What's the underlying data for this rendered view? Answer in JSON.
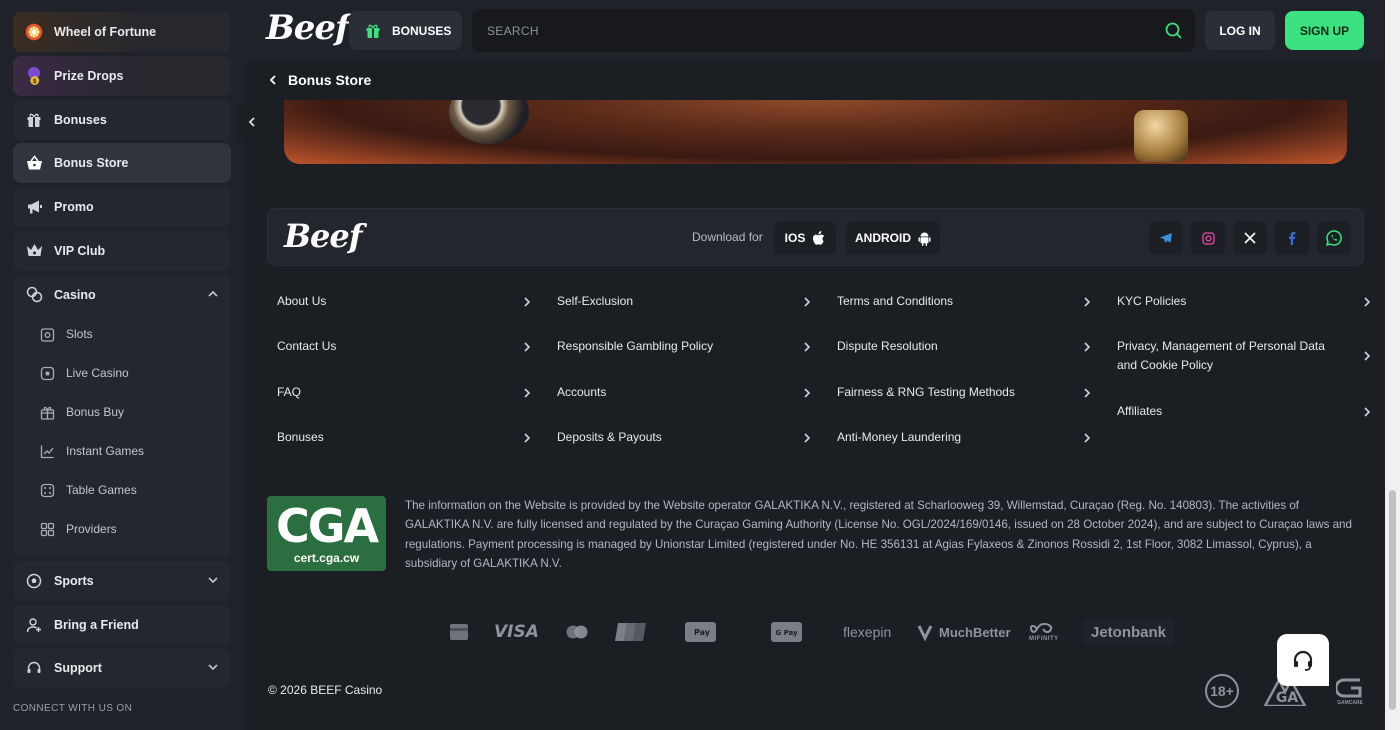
{
  "sidebar": {
    "top_items": [
      {
        "label": "Wheel of Fortune",
        "icon": "wheel-icon"
      },
      {
        "label": "Prize Drops",
        "icon": "prize-drops-icon"
      },
      {
        "label": "Bonuses",
        "icon": "gift-icon"
      },
      {
        "label": "Bonus Store",
        "icon": "basket-icon",
        "active": true
      },
      {
        "label": "Promo",
        "icon": "megaphone-icon"
      },
      {
        "label": "VIP Club",
        "icon": "crown-icon"
      }
    ],
    "casino": {
      "label": "Casino",
      "sub_items": [
        {
          "label": "Slots",
          "icon": "slots-icon"
        },
        {
          "label": "Live Casino",
          "icon": "live-casino-icon"
        },
        {
          "label": "Bonus Buy",
          "icon": "bonus-buy-icon"
        },
        {
          "label": "Instant Games",
          "icon": "instant-games-icon"
        },
        {
          "label": "Table Games",
          "icon": "dice-icon"
        },
        {
          "label": "Providers",
          "icon": "providers-icon"
        }
      ]
    },
    "bottom_items": [
      {
        "label": "Sports",
        "icon": "sports-ball-icon"
      },
      {
        "label": "Bring a Friend",
        "icon": "add-user-icon"
      },
      {
        "label": "Support",
        "icon": "headset-icon"
      }
    ],
    "connect_label": "CONNECT WITH US ON"
  },
  "header": {
    "logo": "Beef",
    "bonuses_label": "BONUSES",
    "search_placeholder": "SEARCH",
    "login_label": "LOG IN",
    "signup_label": "SIGN UP"
  },
  "breadcrumb": {
    "title": "Bonus Store"
  },
  "footer_bar": {
    "logo": "Beef",
    "download_label": "Download for",
    "ios_label": "IOS",
    "android_label": "ANDROID",
    "socials": [
      "telegram-icon",
      "instagram-icon",
      "x-icon",
      "facebook-icon",
      "whatsapp-icon"
    ]
  },
  "footer_links": [
    [
      "About Us",
      "Contact Us",
      "FAQ",
      "Bonuses"
    ],
    [
      "Self-Exclusion",
      "Responsible Gambling Policy",
      "Accounts",
      "Deposits & Payouts"
    ],
    [
      "Terms and Conditions",
      "Dispute Resolution",
      "Fairness & RNG Testing Methods",
      "Anti-Money Laundering"
    ],
    [
      "KYC Policies",
      "Privacy, Management of Personal Data and Cookie Policy",
      "Affiliates"
    ]
  ],
  "license": {
    "badge_big": "CGA",
    "badge_small": "cert.cga.cw",
    "text": "The information on the Website is provided by the Website operator GALAKTIKA N.V., registered at Scharlooweg 39, Willemstad, Curaçao (Reg. No. 140803). The activities of GALAKTIKA N.V. are fully licensed and regulated by the Curaçao Gaming Authority (License No. OGL/2024/169/0146, issued on 28 October 2024), and are subject to Curaçao laws and regulations. Payment processing is managed by Unionstar Limited (registered under No. HE 356131 at Agias Fylaxeos & Zinonos Rossidi 2, 1st Floor, 3082 Limassol, Cyprus), a subsidiary of GALAKTIKA N.V."
  },
  "payments": {
    "visa": "VISA",
    "flexepin": "flexepin",
    "muchbetter": "MuchBetter",
    "mifinity": "MIFINITY",
    "jetonbank": "Jetonbank",
    "applepay": "Pay",
    "googlepay": "G Pay"
  },
  "copyright": "© 2026 BEEF Casino",
  "badges": {
    "age": "18+",
    "gamcare": "GAMCARE"
  },
  "colors": {
    "accent_green": "#3ce27f",
    "bg": "#1b1e23",
    "sidebar": "#1f2228"
  }
}
